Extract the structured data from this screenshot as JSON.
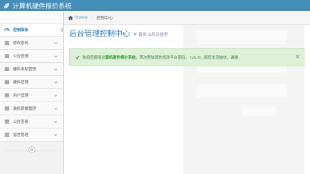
{
  "app": {
    "title": "计算机硬件报价系统"
  },
  "sidebar": {
    "items": [
      {
        "label": "控制面板",
        "icon": "dashboard-icon",
        "active": true
      },
      {
        "label": "修改密码",
        "icon": "list-icon"
      },
      {
        "label": "公告管理",
        "icon": "list-icon"
      },
      {
        "label": "硬件类型管理",
        "icon": "list-icon"
      },
      {
        "label": "硬件管理",
        "icon": "list-icon"
      },
      {
        "label": "用户管理",
        "icon": "list-icon"
      },
      {
        "label": "装机套餐管理",
        "icon": "list-icon"
      },
      {
        "label": "公告查看",
        "icon": "list-icon"
      },
      {
        "label": "留言管理",
        "icon": "list-icon"
      }
    ]
  },
  "breadcrumbs": {
    "home": "Home",
    "current": "控制中心"
  },
  "page_header": {
    "title": "后台管理控制中心",
    "sub": "首页 &欢迎使用"
  },
  "alert": {
    "prefix": "欢迎您使用 ",
    "app_name": "计算机硬件报价系统",
    "suffix": "，首次登陆请先修改平台密码。 (v1.0) ,祝您生活愉快，谢谢."
  },
  "colors": {
    "topbar": "#438eb9",
    "accent": "#2679b5",
    "alert_bg": "#dff0d8",
    "alert_text": "#3c763d"
  }
}
